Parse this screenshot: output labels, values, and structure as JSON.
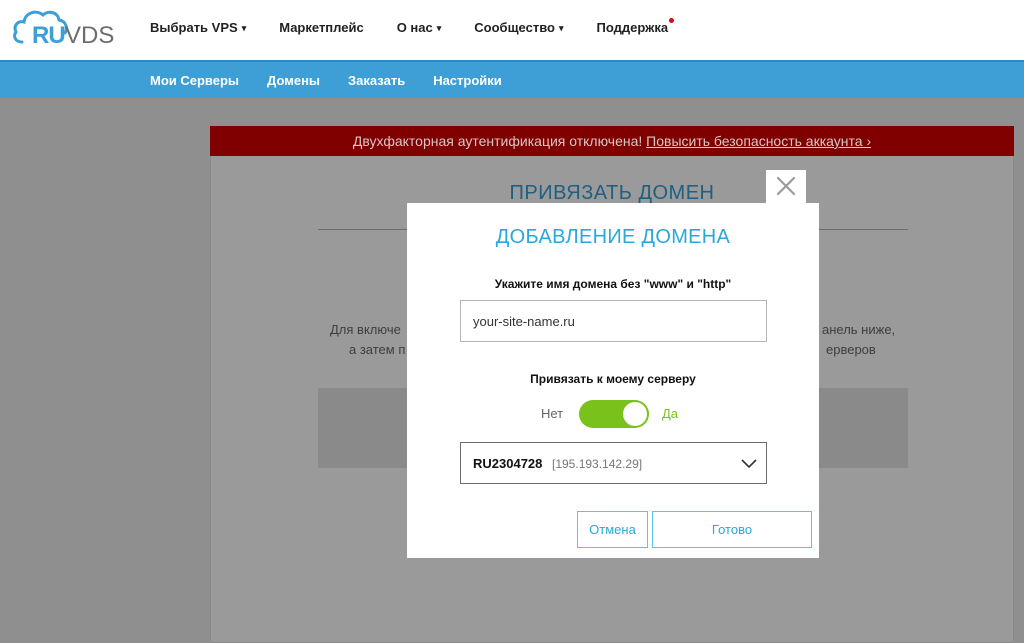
{
  "header": {
    "logo": {
      "ru": "RU",
      "vds": "VDS"
    },
    "nav": [
      {
        "label": "Выбрать VPS",
        "caret": "▾"
      },
      {
        "label": "Маркетплейс"
      },
      {
        "label": "О нас",
        "caret": "▾"
      },
      {
        "label": "Сообщество",
        "caret": "▾"
      },
      {
        "label": "Поддержка"
      }
    ]
  },
  "subnav": [
    "Мои Серверы",
    "Домены",
    "Заказать",
    "Настройки"
  ],
  "alert": {
    "text": "Двухфакторная аутентификация отключена! ",
    "link": "Повысить безопасность аккаунта ›"
  },
  "background_page": {
    "title": "ПРИВЯЗАТЬ ДОМЕН",
    "line1_left": "Для включе",
    "line1_right": "анель ниже,",
    "line2_left": "а затем п",
    "line2_right": "ерверов"
  },
  "modal": {
    "title": "ДОБАВЛЕНИЕ ДОМЕНА",
    "domain_label": "Укажите имя домена без \"www\" и \"http\"",
    "domain_placeholder": "your-site-name.ru",
    "bind_label": "Привязать к моему серверу",
    "toggle_off_label": "Нет",
    "toggle_on_label": "Да",
    "toggle_state": true,
    "server_id": "RU2304728",
    "server_ip": "[195.193.142.29]",
    "cancel_label": "Отмена",
    "done_label": "Готово"
  },
  "colors": {
    "accent": "#2aa9d8",
    "subnav": "#3e9fd6",
    "alert": "#800000",
    "toggle": "#79c21b"
  }
}
